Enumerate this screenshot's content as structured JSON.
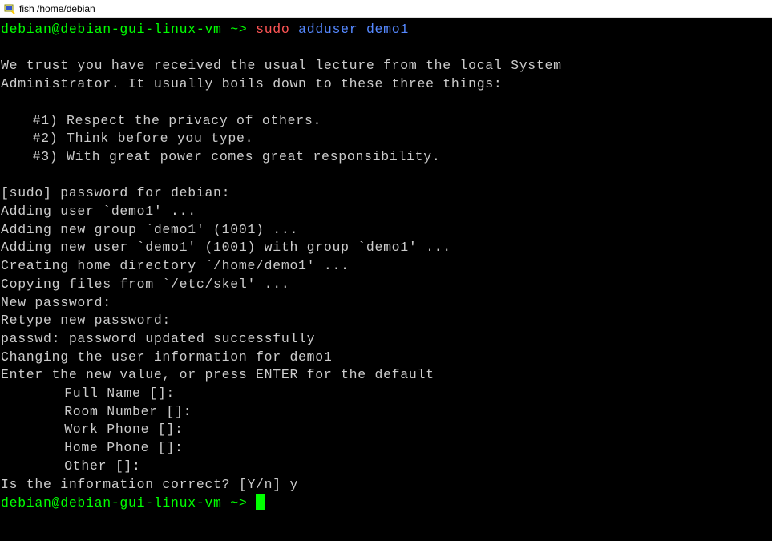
{
  "window": {
    "title": "fish /home/debian"
  },
  "prompt": {
    "userhost": "debian@debian-gui-linux-vm",
    "tilde": "~",
    "arrow": ">"
  },
  "command": {
    "sudo": "sudo",
    "args": "adduser demo1"
  },
  "lecture": {
    "line1": "We trust you have received the usual lecture from the local System",
    "line2": "Administrator. It usually boils down to these three things:",
    "rule1": "#1) Respect the privacy of others.",
    "rule2": "#2) Think before you type.",
    "rule3": "#3) With great power comes great responsibility."
  },
  "output": {
    "sudopass": "[sudo] password for debian:",
    "adding_user": "Adding user `demo1' ...",
    "adding_group": "Adding new group `demo1' (1001) ...",
    "adding_newuser": "Adding new user `demo1' (1001) with group `demo1' ...",
    "creating_home": "Creating home directory `/home/demo1' ...",
    "copying_files": "Copying files from `/etc/skel' ...",
    "new_password": "New password:",
    "retype_password": "Retype new password:",
    "passwd_updated": "passwd: password updated successfully",
    "changing_info": "Changing the user information for demo1",
    "enter_value": "Enter the new value, or press ENTER for the default",
    "full_name": "Full Name []:",
    "room_number": "Room Number []:",
    "work_phone": "Work Phone []:",
    "home_phone": "Home Phone []:",
    "other": "Other []:",
    "confirm": "Is the information correct? [Y/n] y"
  }
}
